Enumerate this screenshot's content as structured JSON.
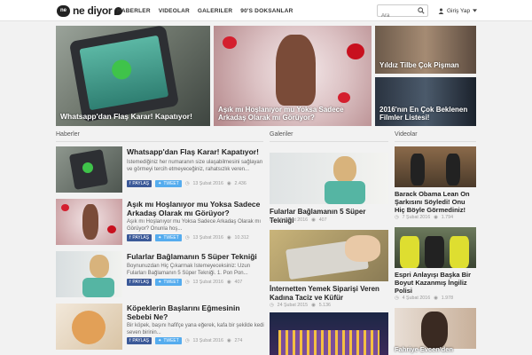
{
  "header": {
    "logo_badge": "ne",
    "logo_text": "ne diyor",
    "nav": [
      "HABERLER",
      "VIDEOLAR",
      "GALERILER",
      "90'S DOKSANLAR"
    ],
    "search_placeholder": "Ara",
    "login_label": "Giriş Yap"
  },
  "featured": [
    {
      "title": "Whatsapp'dan Flaş Karar! Kapatıyor!"
    },
    {
      "title": "Aşık mı Hoşlanıyor mu Yoksa Sadece Arkadaş Olarak mı Görüyor?"
    },
    {
      "title": "Yıldız Tilbe Çok Pişman"
    },
    {
      "title": "2016'nın En Çok Beklenen Filmler Listesi!"
    }
  ],
  "sections": {
    "news": "Haberler",
    "galleries": "Galeriler",
    "videos": "Videolar"
  },
  "news": [
    {
      "title": "Whatsapp'dan Flaş Karar! Kapatıyor!",
      "desc": "İstemediğiniz her numaranın size ulaşabilmesini sağlayan ve görmeyi tercih etmeyeceğiniz, rahatsızlık veren...",
      "share": "PAYLAŞ",
      "tweet": "TWEET",
      "date": "13 Şubat 2016",
      "views": "2.436"
    },
    {
      "title": "Aşık mı Hoşlanıyor mu Yoksa Sadece Arkadaş Olarak mı Görüyor?",
      "desc": "Aşık mı Hoşlanıyor mu Yoksa Sadece Arkadaş Olarak mı Görüyor? Onunla hoş...",
      "share": "PAYLAŞ",
      "tweet": "TWEET",
      "date": "13 Şubat 2016",
      "views": "10.312"
    },
    {
      "title": "Fularlar Bağlamanın 5 Süper Tekniği",
      "desc": "Boynunuzdan Hiç Çıkarmak İstemeyeceksiniz: Uzun Fularları Bağlamanın 5 Süper Tekniği. 1. Pon Pon...",
      "share": "PAYLAŞ",
      "tweet": "TWEET",
      "date": "13 Şubat 2016",
      "views": "407"
    },
    {
      "title": "Köpeklerin Başlarını Eğmesinin Sebebi Ne?",
      "desc": "Bir köpek, başını hafifçe yana eğerek, kafa bir şekilde kedi seven birinin...",
      "share": "PAYLAŞ",
      "tweet": "TWEET",
      "date": "13 Şubat 2016",
      "views": "274"
    }
  ],
  "galleries": [
    {
      "title": "Fularlar Bağlamanın 5 Süper Tekniği",
      "date": "13 Şubat 2016",
      "views": "407"
    },
    {
      "title": "İnternetten Yemek Siparişi Veren Kadına Taciz ve Küfür",
      "date": "24 Şubat 2015",
      "views": "5.136"
    }
  ],
  "videos": [
    {
      "title": "Barack Obama Lean On Şarkısını Söyledi! Onu Hiç Böyle Görmediniz!",
      "date": "7 Şubat 2016",
      "views": "1.794"
    },
    {
      "title": "Espri Anlayışı Başka Bir Boyut Kazanmış İngiliz Polisi",
      "date": "4 Şubat 2016",
      "views": "1.978"
    },
    {
      "title": "Fahriye Evcen'den"
    }
  ],
  "colors": {
    "facebook": "#3b5998",
    "twitter": "#55acee"
  }
}
